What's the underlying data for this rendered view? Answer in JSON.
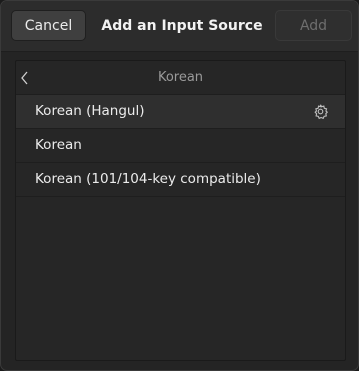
{
  "header": {
    "cancel_label": "Cancel",
    "title": "Add an Input Source",
    "add_label": "Add"
  },
  "list": {
    "back_icon": "chevron-left-icon",
    "title": "Korean",
    "items": [
      {
        "label": "Korean (Hangul)",
        "icon": "gear-icon",
        "selected": true
      },
      {
        "label": "Korean"
      },
      {
        "label": "Korean (101/104-key compatible)"
      }
    ]
  },
  "colors": {
    "background": "#242424",
    "headerbar": "#2c2c2c",
    "button": "#3f3f3f",
    "text": "#ebebeb",
    "muted_text": "#9a9a9a"
  }
}
